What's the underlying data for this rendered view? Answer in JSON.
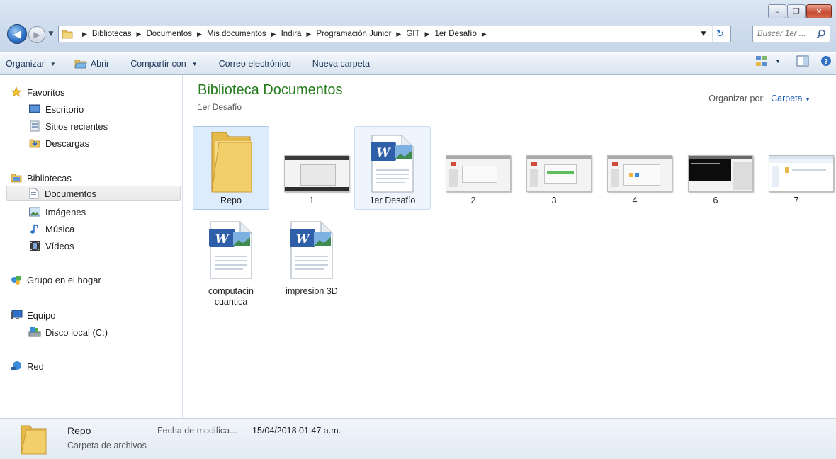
{
  "window": {
    "controls": {
      "minimize": "–",
      "maximize": "❐",
      "close": "✕"
    }
  },
  "navigation": {
    "back_icon": "arrow-left-icon",
    "forward_icon": "arrow-right-icon",
    "breadcrumb": [
      "Bibliotecas",
      "Documentos",
      "Mis documentos",
      "Indira",
      "Programación Junior",
      "GIT",
      "1er Desafío"
    ],
    "search_placeholder": "Buscar 1er ..."
  },
  "toolbar": {
    "organize": "Organizar",
    "open": "Abrir",
    "share": "Compartir con",
    "email": "Correo electrónico",
    "new_folder": "Nueva carpeta"
  },
  "sidebar": {
    "favorites": "Favoritos",
    "desktop": "Escritorio",
    "recent": "Sitios recientes",
    "downloads": "Descargas",
    "libraries": "Bibliotecas",
    "documents": "Documentos",
    "images": "Imágenes",
    "music": "Música",
    "videos": "Vídeos",
    "homegroup": "Grupo en el hogar",
    "computer": "Equipo",
    "local_disk": "Disco local (C:)",
    "network": "Red"
  },
  "content": {
    "title": "Biblioteca Documentos",
    "subtitle": "1er Desafío",
    "arrange_label": "Organizar por:",
    "arrange_value": "Carpeta",
    "items": [
      {
        "name": "Repo",
        "kind": "folder"
      },
      {
        "name": "1",
        "kind": "image"
      },
      {
        "name": "1er Desafío",
        "kind": "word"
      },
      {
        "name": "2",
        "kind": "image"
      },
      {
        "name": "3",
        "kind": "image"
      },
      {
        "name": "4",
        "kind": "image"
      },
      {
        "name": "6",
        "kind": "image"
      },
      {
        "name": "7",
        "kind": "image"
      },
      {
        "name": "computacin cuantica",
        "kind": "word"
      },
      {
        "name": "impresion 3D",
        "kind": "word"
      }
    ]
  },
  "status": {
    "name": "Repo",
    "type": "Carpeta de archivos",
    "date_label": "Fecha de modifica...",
    "date": "15/04/2018 01:47 a.m."
  },
  "colors": {
    "accent": "#267c1e",
    "link": "#1e5fb4",
    "selection": "#dcecfc"
  }
}
